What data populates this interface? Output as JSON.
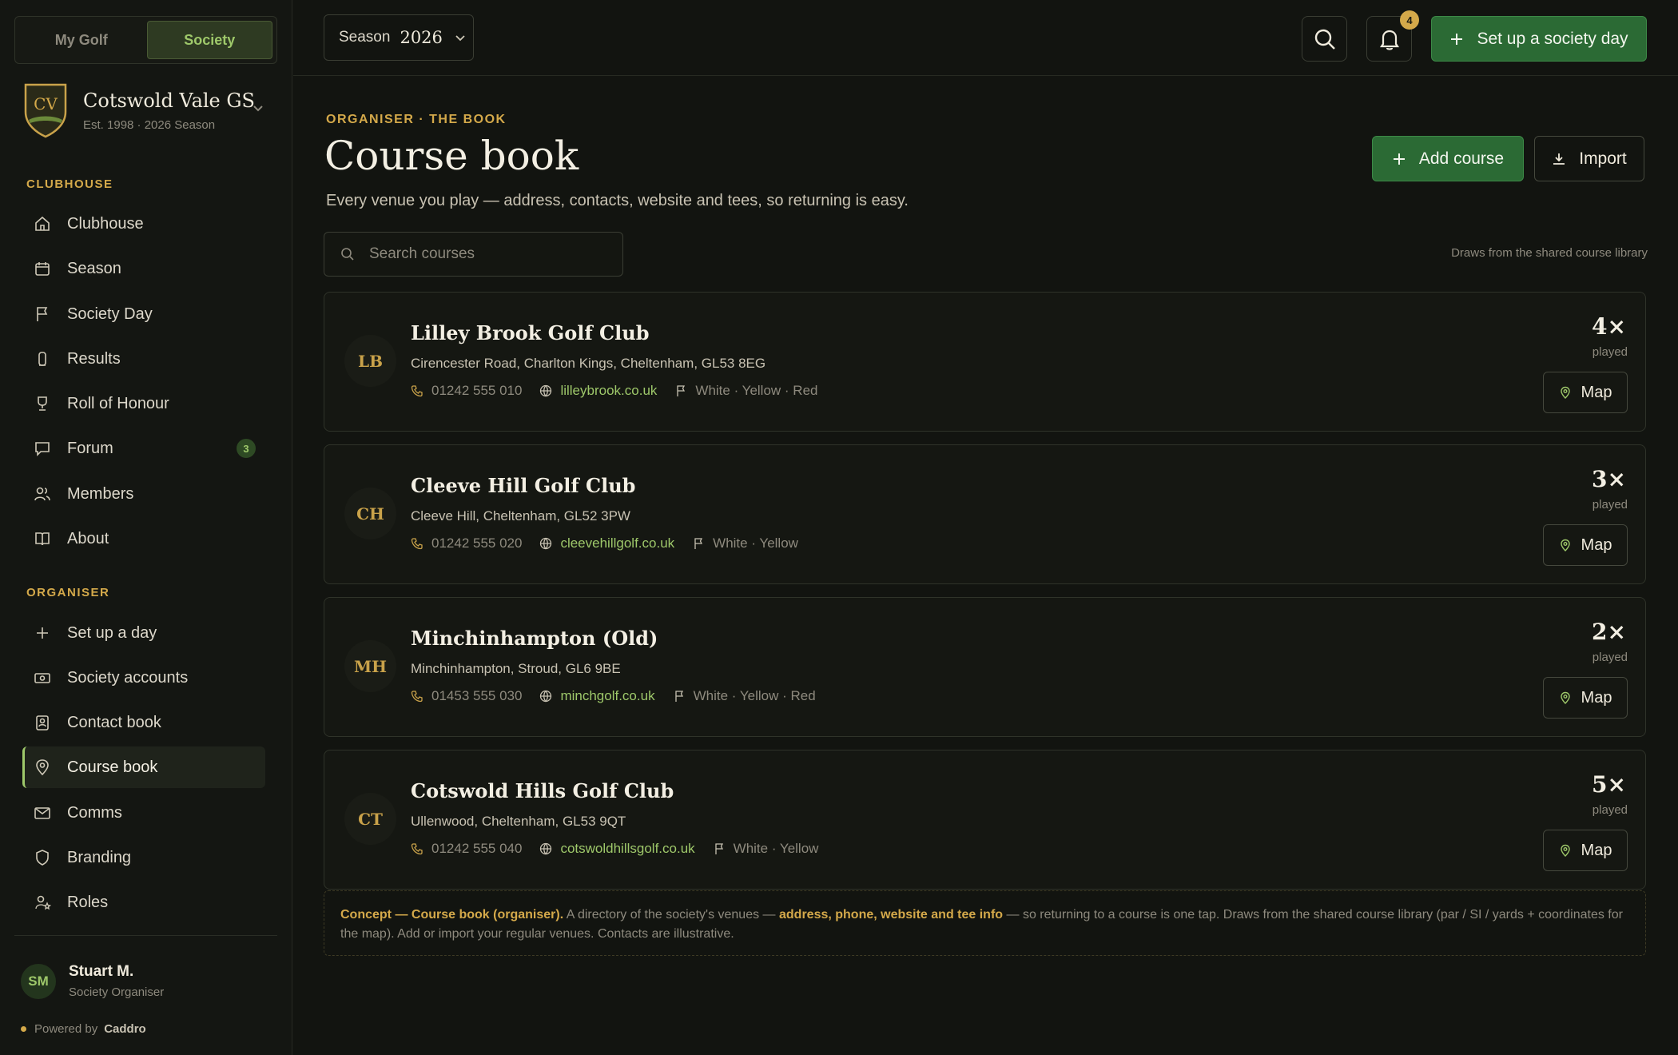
{
  "mode_toggle": {
    "my_golf": "My Golf",
    "society": "Society"
  },
  "society": {
    "initials": "CV",
    "name": "Cotswold Vale GS",
    "subtitle": "Est. 1998 · 2026 Season"
  },
  "sidebar": {
    "clubhouse_label": "CLUBHOUSE",
    "clubhouse_items": [
      {
        "label": "Clubhouse",
        "icon": "home-icon"
      },
      {
        "label": "Season",
        "icon": "calendar-icon"
      },
      {
        "label": "Society Day",
        "icon": "flag-icon"
      },
      {
        "label": "Results",
        "icon": "trophy-icon"
      },
      {
        "label": "Roll of Honour",
        "icon": "cup-icon"
      },
      {
        "label": "Forum",
        "icon": "chat-icon",
        "badge": "3"
      },
      {
        "label": "Members",
        "icon": "users-icon"
      },
      {
        "label": "About",
        "icon": "book-icon"
      }
    ],
    "organiser_label": "ORGANISER",
    "organiser_items": [
      {
        "label": "Set up a day",
        "icon": "plus-icon"
      },
      {
        "label": "Society accounts",
        "icon": "cash-icon"
      },
      {
        "label": "Contact book",
        "icon": "contact-icon"
      },
      {
        "label": "Course book",
        "icon": "pin-icon",
        "active": true
      },
      {
        "label": "Comms",
        "icon": "mail-icon"
      },
      {
        "label": "Branding",
        "icon": "shield-icon"
      },
      {
        "label": "Roles",
        "icon": "user-star-icon"
      }
    ]
  },
  "user": {
    "initials": "SM",
    "name": "Stuart M.",
    "role": "Society Organiser"
  },
  "powered": {
    "prefix": "Powered by",
    "brand": "Caddro"
  },
  "topbar": {
    "season_label": "Season",
    "season_value": "2026",
    "notifications_count": "4",
    "setup_button": "Set up a society day"
  },
  "page": {
    "eyebrow": "ORGANISER · THE BOOK",
    "title": "Course book",
    "subtitle": "Every venue you play — address, contacts, website and tees, so returning is easy.",
    "add_button": "Add course",
    "import_button": "Import",
    "search_placeholder": "Search courses",
    "library_note": "Draws from the shared course library",
    "played_label": "played",
    "map_label": "Map"
  },
  "courses": [
    {
      "initials": "LB",
      "name": "Lilley Brook Golf Club",
      "address": "Cirencester Road, Charlton Kings, Cheltenham, GL53 8EG",
      "phone": "01242 555 010",
      "website": "lilleybrook.co.uk",
      "tees": "White · Yellow · Red",
      "played": "4×"
    },
    {
      "initials": "CH",
      "name": "Cleeve Hill Golf Club",
      "address": "Cleeve Hill, Cheltenham, GL52 3PW",
      "phone": "01242 555 020",
      "website": "cleevehillgolf.co.uk",
      "tees": "White · Yellow",
      "played": "3×"
    },
    {
      "initials": "MH",
      "name": "Minchinhampton (Old)",
      "address": "Minchinhampton, Stroud, GL6 9BE",
      "phone": "01453 555 030",
      "website": "minchgolf.co.uk",
      "tees": "White · Yellow · Red",
      "played": "2×"
    },
    {
      "initials": "CT",
      "name": "Cotswold Hills Golf Club",
      "address": "Ullenwood, Cheltenham, GL53 9QT",
      "phone": "01242 555 040",
      "website": "cotswoldhillsgolf.co.uk",
      "tees": "White · Yellow",
      "played": "5×"
    }
  ],
  "concept": {
    "lead": "Concept — Course book (organiser).",
    "text1": " A directory of the society's venues — ",
    "highlight": "address, phone, website and tee info",
    "text2": " — so returning to a course is one tap. Draws from the shared course library (par / SI / yards + coordinates for the map). Add or import your regular venues. Contacts are illustrative."
  },
  "colors": {
    "accent_green": "#9ec86a",
    "accent_gold": "#d4a94a",
    "primary_button": "#2b6a34",
    "background": "#121410"
  }
}
